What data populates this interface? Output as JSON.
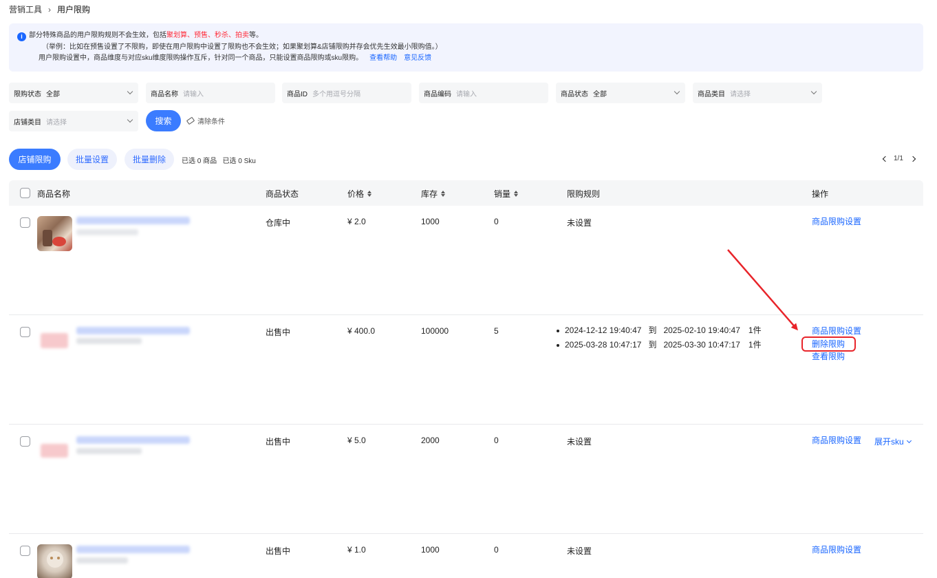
{
  "breadcrumb": {
    "parent": "营销工具",
    "separator": "›",
    "current": "用户限购"
  },
  "notice": {
    "line1_prefix": "部分特殊商品的用户限购规则不会生效，包括",
    "line1_highlight": "聚划算、预售、秒杀、拍卖",
    "line1_suffix": "等。",
    "line2": "（举例：比如在预售设置了不限购，即使在用户限购中设置了限购也不会生效；如果聚划算&店铺限购并存会优先生效最小限购值。）",
    "line3": "用户限购设置中，商品维度与对应sku维度限购操作互斥，针对同一个商品，只能设置商品限购或sku限购。",
    "help_link": "查看帮助",
    "feedback_link": "意见反馈"
  },
  "filters": {
    "status": {
      "label": "限购状态",
      "value": "全部"
    },
    "name": {
      "label": "商品名称",
      "placeholder": "请输入"
    },
    "id": {
      "label": "商品ID",
      "placeholder": "多个用逗号分隔"
    },
    "code": {
      "label": "商品编码",
      "placeholder": "请输入"
    },
    "goods_status": {
      "label": "商品状态",
      "value": "全部"
    },
    "category": {
      "label": "商品类目",
      "placeholder": "请选择"
    },
    "shop_category": {
      "label": "店铺类目",
      "placeholder": "请选择"
    },
    "search_label": "搜索",
    "clear_label": "清除条件"
  },
  "toolbar": {
    "shop_limit": "店铺限购",
    "batch_set": "批量设置",
    "batch_delete": "批量删除",
    "selected": "已选 0 商品   已选 0 Sku",
    "page": "1/1"
  },
  "table": {
    "headers": {
      "name": "商品名称",
      "status": "商品状态",
      "price": "价格",
      "stock": "库存",
      "sales": "销量",
      "rule": "限购规则",
      "ops": "操作"
    },
    "rows": [
      {
        "status": "仓库中",
        "price": "¥ 2.0",
        "stock": "1000",
        "sales": "0",
        "rule": "未设置",
        "op1": "商品限购设置"
      },
      {
        "status": "出售中",
        "price": "¥ 400.0",
        "stock": "100000",
        "sales": "5",
        "rules": [
          {
            "start": "2024-12-12 19:40:47",
            "to": "到",
            "end": "2025-02-10 19:40:47",
            "qty": "1件"
          },
          {
            "start": "2025-03-28 10:47:17",
            "to": "到",
            "end": "2025-03-30 10:47:17",
            "qty": "1件"
          }
        ],
        "op1": "商品限购设置",
        "op2": "删除限购",
        "op3": "查看限购"
      },
      {
        "status": "出售中",
        "price": "¥ 5.0",
        "stock": "2000",
        "sales": "0",
        "rule": "未设置",
        "op1": "商品限购设置",
        "op_expand": "展开sku"
      },
      {
        "status": "出售中",
        "price": "¥ 1.0",
        "stock": "1000",
        "sales": "0",
        "rule": "未设置",
        "op1": "商品限购设置"
      }
    ]
  },
  "colors": {
    "primary": "#3b7cff",
    "link": "#1966ff",
    "highlight_red": "#e8242a"
  }
}
